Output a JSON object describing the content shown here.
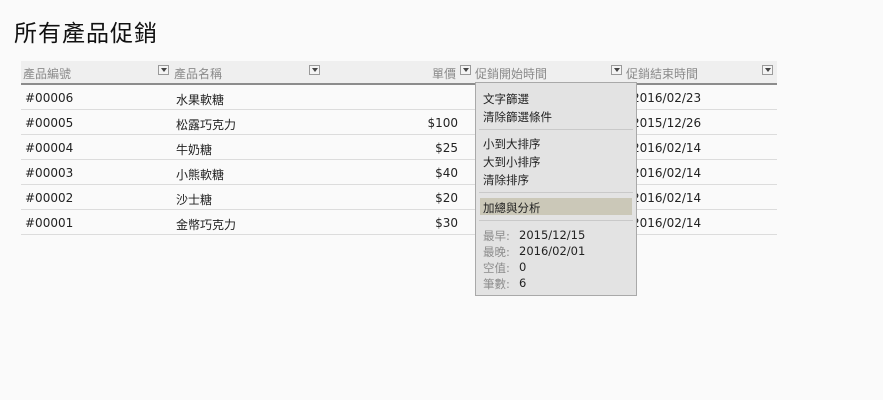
{
  "page_title": "所有產品促銷",
  "columns": {
    "id": "產品編號",
    "name": "產品名稱",
    "price": "單價",
    "start": "促銷開始時間",
    "end": "促銷結束時間"
  },
  "rows": [
    {
      "id": "#00006",
      "name": "水果軟糖",
      "price": "",
      "end": "2016/02/23"
    },
    {
      "id": "#00005",
      "name": "松露巧克力",
      "price": "$100",
      "end": "2015/12/26"
    },
    {
      "id": "#00004",
      "name": "牛奶糖",
      "price": "$25",
      "end": "2016/02/14"
    },
    {
      "id": "#00003",
      "name": "小熊軟糖",
      "price": "$40",
      "end": "2016/02/14"
    },
    {
      "id": "#00002",
      "name": "沙士糖",
      "price": "$20",
      "end": "2016/02/14"
    },
    {
      "id": "#00001",
      "name": "金幣巧克力",
      "price": "$30",
      "end": "2016/02/14"
    }
  ],
  "filter_menu": {
    "text_filter": "文字篩選",
    "clear_filter": "清除篩選條件",
    "sort_asc": "小到大排序",
    "sort_desc": "大到小排序",
    "clear_sort": "清除排序",
    "totals": "加總與分析",
    "stats": {
      "earliest_label": "最早:",
      "earliest_value": "2015/12/15",
      "latest_label": "最晚:",
      "latest_value": "2016/02/01",
      "empty_label": "空值:",
      "empty_value": "0",
      "count_label": "筆數:",
      "count_value": "6"
    }
  },
  "colors": {
    "highlight": "#cbc8b8",
    "menu_bg": "#e3e3e3",
    "header_bg": "#efefef"
  },
  "icons": {
    "column_dropdown": "chevron-down-icon"
  }
}
